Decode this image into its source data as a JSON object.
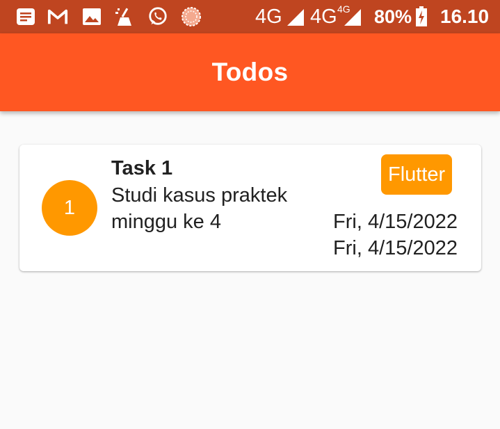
{
  "status_bar": {
    "network_1": "4G",
    "network_2": "4G",
    "network_2_sup": "4G",
    "battery": "80%",
    "time": "16.10",
    "icons": [
      "notes-icon",
      "gmail-icon",
      "gallery-icon",
      "cleaner-icon",
      "whatsapp-icon",
      "loading-icon",
      "signal-icon",
      "signal-icon",
      "battery-charging-icon"
    ]
  },
  "app_bar": {
    "title": "Todos"
  },
  "todos": [
    {
      "number": "1",
      "title": "Task 1",
      "description": "Studi kasus praktek minggu ke 4",
      "tag": "Flutter",
      "start_date": "Fri, 4/15/2022",
      "end_date": "Fri, 4/15/2022"
    }
  ],
  "colors": {
    "status_bar": "#bf4520",
    "app_bar": "#ff5722",
    "accent": "#ff9800",
    "background": "#fafafa"
  }
}
